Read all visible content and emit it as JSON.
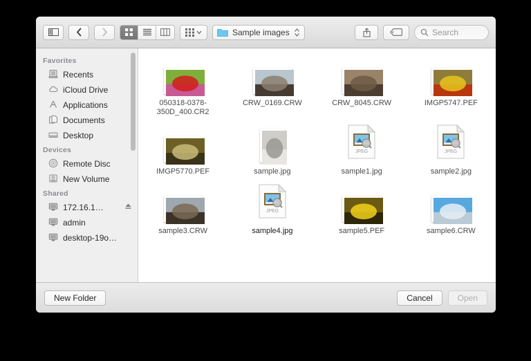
{
  "toolbar": {
    "sidebar_toggle_icon": "sidebar-toggle-icon",
    "back_icon": "chevron-left-icon",
    "forward_icon": "chevron-right-icon",
    "view_icon_label": "icon-view-icon",
    "view_list_label": "list-view-icon",
    "view_column_label": "column-view-icon",
    "arrange_icon": "arrange-by-icon",
    "path_label": "Sample images",
    "folder_icon": "folder-icon",
    "stepper_icon": "up-down-stepper-icon",
    "share_icon": "share-icon",
    "tag_icon": "tag-icon",
    "search_icon": "search-icon",
    "search_placeholder": "Search",
    "search_value": ""
  },
  "sidebar": {
    "sections": [
      {
        "title": "Favorites",
        "items": [
          {
            "label": "Recents",
            "icon": "recents-icon"
          },
          {
            "label": "iCloud Drive",
            "icon": "cloud-icon"
          },
          {
            "label": "Applications",
            "icon": "applications-icon"
          },
          {
            "label": "Documents",
            "icon": "documents-icon"
          },
          {
            "label": "Desktop",
            "icon": "desktop-icon"
          }
        ]
      },
      {
        "title": "Devices",
        "items": [
          {
            "label": "Remote Disc",
            "icon": "disc-icon"
          },
          {
            "label": "New Volume",
            "icon": "drive-icon"
          }
        ]
      },
      {
        "title": "Shared",
        "items": [
          {
            "label": "172.16.1…",
            "icon": "display-icon",
            "eject": "eject-icon"
          },
          {
            "label": "admin",
            "icon": "display-icon"
          },
          {
            "label": "desktop-19o…",
            "icon": "display-icon"
          }
        ]
      }
    ]
  },
  "files": [
    {
      "name": "050318-0378-350D_400.CR2",
      "kind": "photo",
      "orient": "land",
      "selected": false,
      "colors": [
        "#7fae3c",
        "#d21b1b",
        "#c85a94"
      ]
    },
    {
      "name": "CRW_0169.CRW",
      "kind": "photo",
      "orient": "land",
      "selected": false,
      "colors": [
        "#b9c6cd",
        "#8a7f6e",
        "#453b33"
      ]
    },
    {
      "name": "CRW_8045.CRW",
      "kind": "photo",
      "orient": "land",
      "selected": false,
      "colors": [
        "#9a8368",
        "#6d5b46",
        "#4b3d2f"
      ]
    },
    {
      "name": "IMGP5747.PEF",
      "kind": "photo",
      "orient": "land",
      "selected": false,
      "colors": [
        "#8f7c3a",
        "#e8c41d",
        "#b8370d"
      ]
    },
    {
      "name": "IMGP5770.PEF",
      "kind": "photo",
      "orient": "land",
      "selected": false,
      "colors": [
        "#6d5f25",
        "#c8bb7a",
        "#3a3318"
      ]
    },
    {
      "name": "sample.jpg",
      "kind": "photo",
      "orient": "port",
      "selected": false,
      "colors": [
        "#cfcdc8",
        "#9a9892",
        "#e8e6e2"
      ]
    },
    {
      "name": "sample1.jpg",
      "kind": "jpeg-doc",
      "badge": "JPEG",
      "selected": false
    },
    {
      "name": "sample2.jpg",
      "kind": "jpeg-doc",
      "badge": "JPEG",
      "selected": false
    },
    {
      "name": "sample3.CRW",
      "kind": "photo",
      "orient": "land",
      "selected": false,
      "colors": [
        "#9fa8ae",
        "#7a6a55",
        "#3b3228"
      ]
    },
    {
      "name": "sample4.jpg",
      "kind": "jpeg-doc",
      "badge": "JPEG",
      "selected": true
    },
    {
      "name": "sample5.PEF",
      "kind": "photo",
      "orient": "land",
      "selected": false,
      "colors": [
        "#6a5a12",
        "#f2d21a",
        "#2e2708"
      ]
    },
    {
      "name": "sample6.CRW",
      "kind": "photo",
      "orient": "land",
      "selected": false,
      "colors": [
        "#58a8e0",
        "#e6eef4",
        "#b9cbd6"
      ]
    }
  ],
  "footer": {
    "new_folder_label": "New Folder",
    "cancel_label": "Cancel",
    "open_label": "Open",
    "open_disabled": true
  }
}
